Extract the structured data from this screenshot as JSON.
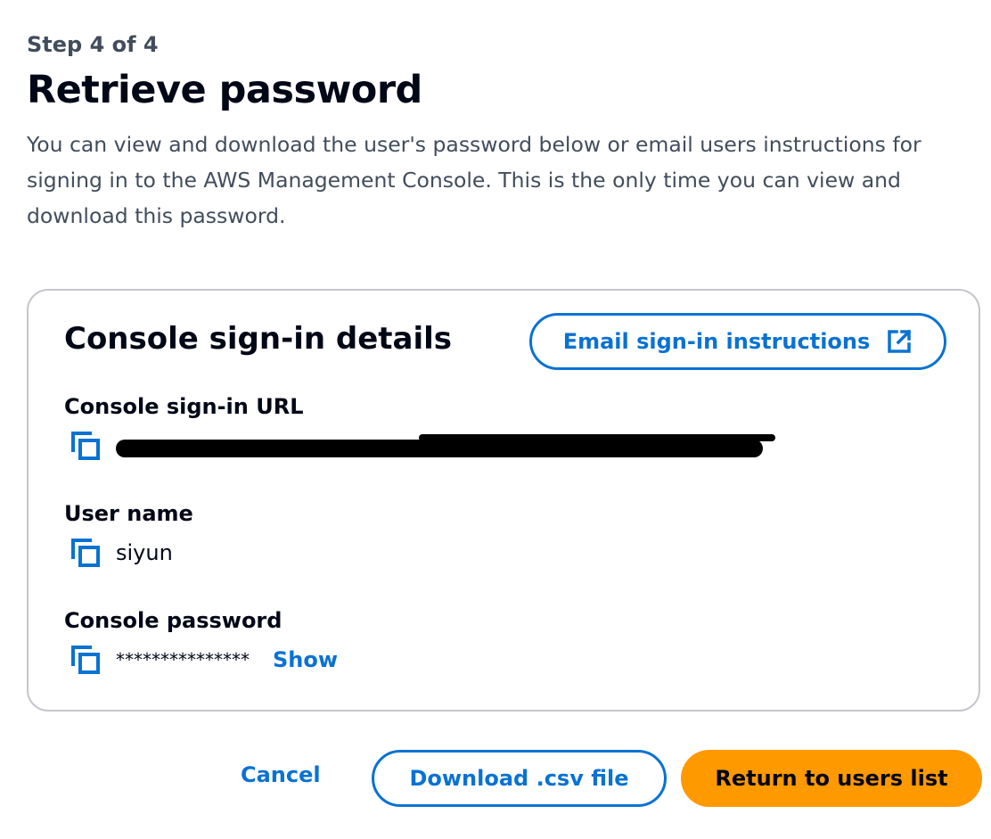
{
  "header": {
    "step": "Step 4 of 4",
    "title": "Retrieve password",
    "description": "You can view and download the user's password below or email users instructions for signing in to the AWS Management Console. This is the only time you can view and download this password."
  },
  "card": {
    "title": "Console sign-in details",
    "email_button_label": "Email sign-in instructions",
    "email_button_icon": "external-link-icon",
    "fields": {
      "url": {
        "label": "Console sign-in URL",
        "copy_icon": "copy-icon",
        "value_redacted": true
      },
      "username": {
        "label": "User name",
        "copy_icon": "copy-icon",
        "value": "siyun"
      },
      "password": {
        "label": "Console password",
        "copy_icon": "copy-icon",
        "value": "***************",
        "show_label": "Show"
      }
    }
  },
  "footer": {
    "cancel_label": "Cancel",
    "download_label": "Download .csv file",
    "primary_label": "Return to users list"
  },
  "colors": {
    "link_blue": "#0972d3",
    "primary_orange": "#ff9900",
    "text_dark": "#000716",
    "text_secondary": "#414d5c",
    "card_border": "#c6c6cd"
  }
}
